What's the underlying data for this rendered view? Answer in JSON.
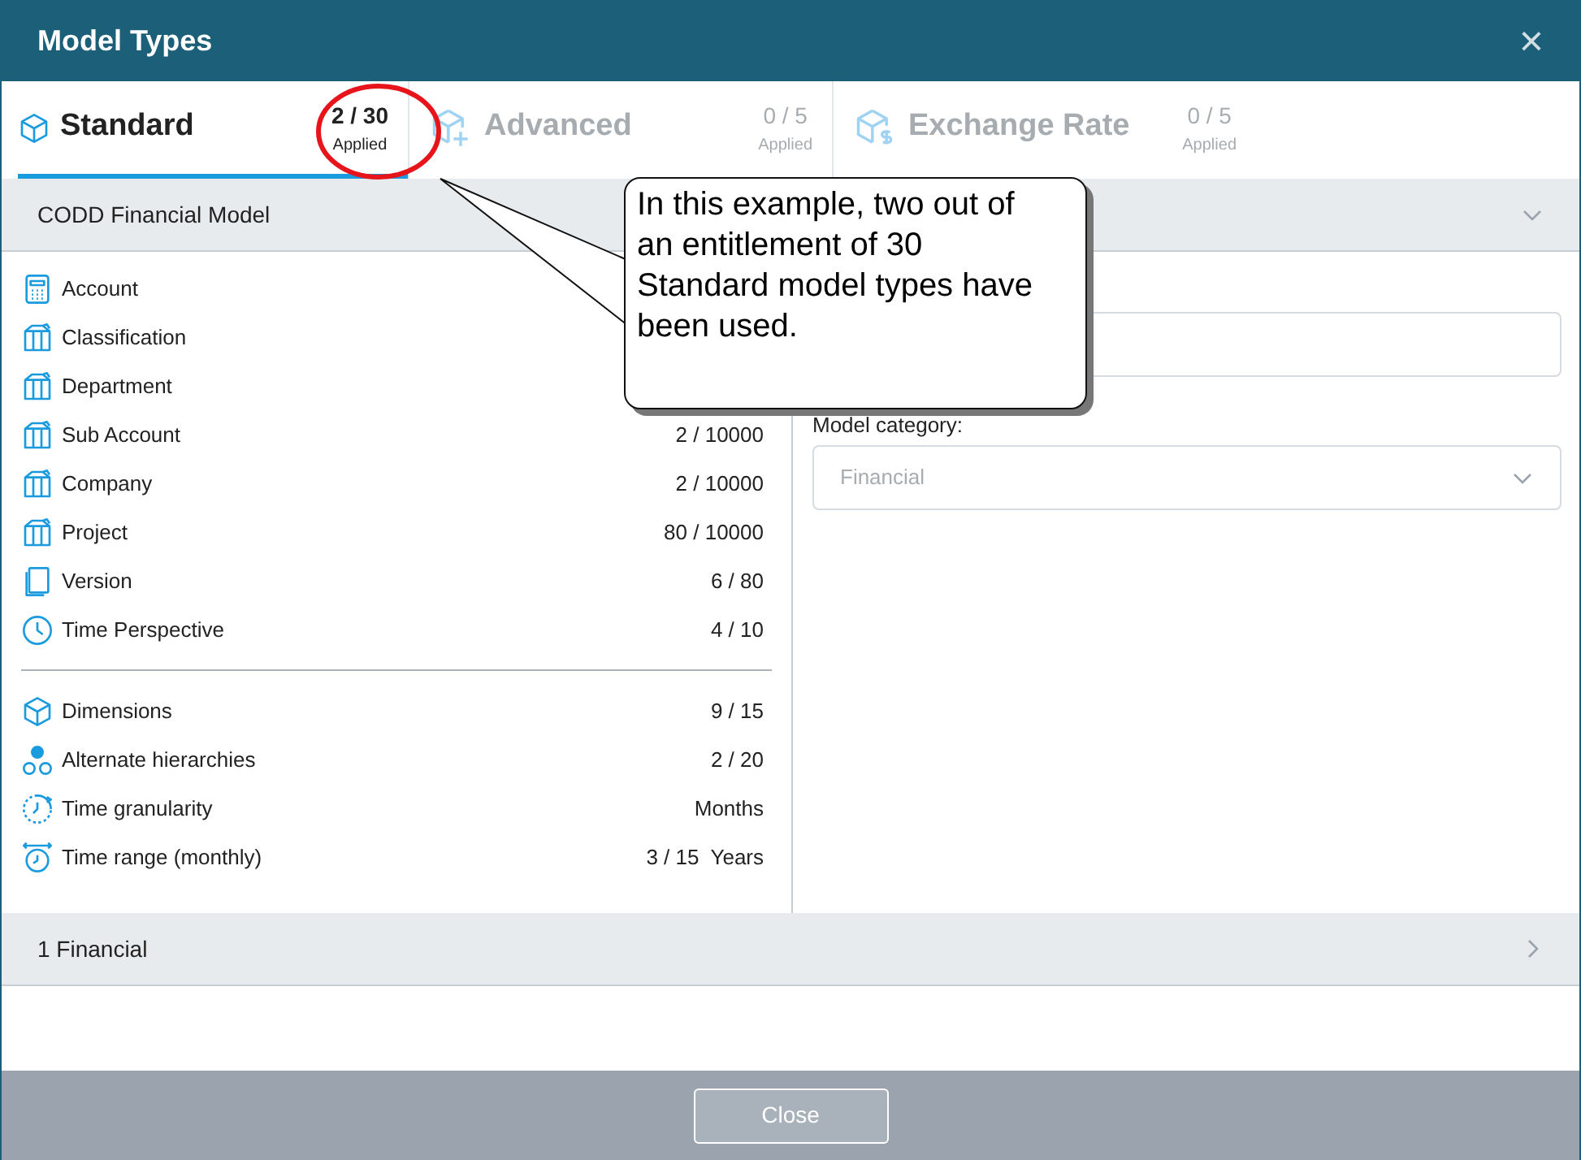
{
  "window": {
    "title": "Model Types",
    "close": "×"
  },
  "tabs": [
    {
      "label": "Standard",
      "count": "2 / 30",
      "sub": "Applied",
      "selected": true,
      "kind": "cube"
    },
    {
      "label": "Advanced",
      "count": "0 / 5",
      "sub": "Applied",
      "selected": false,
      "kind": "cube-plus"
    },
    {
      "label": "Exchange Rate",
      "count": "0 / 5",
      "sub": "Applied",
      "selected": false,
      "kind": "cube-dollar"
    }
  ],
  "section": {
    "title": "CODD Financial Model",
    "expanded": true
  },
  "groups": [
    [
      {
        "kind": "calculator",
        "label": "Account"
      },
      {
        "kind": "tree",
        "label": "Classification"
      },
      {
        "kind": "tree",
        "label": "Department"
      },
      {
        "kind": "tree",
        "label": "Sub Account",
        "value": "2 / 10000"
      },
      {
        "kind": "tree",
        "label": "Company",
        "value": "2 / 10000"
      },
      {
        "kind": "tree",
        "label": "Project",
        "value": "80 / 10000"
      },
      {
        "kind": "pages",
        "label": "Version",
        "value": "6 / 80"
      },
      {
        "kind": "clock",
        "label": "Time Perspective",
        "value": "4 / 10"
      }
    ],
    [
      {
        "kind": "cube",
        "label": "Dimensions",
        "value": "9 / 15"
      },
      {
        "kind": "circles",
        "label": "Alternate hierarchies",
        "value": "2 / 20"
      },
      {
        "kind": "clock-cycle",
        "label": "Time granularity",
        "value": "Months"
      },
      {
        "kind": "clock-range",
        "label": "Time range (monthly)",
        "value": "3 / 15  Years"
      }
    ]
  ],
  "form": {
    "category_label": "Model category:",
    "category_value": "Financial"
  },
  "second_section": {
    "title": "1 Financial",
    "expanded": false
  },
  "callout": "In this example, two out of an entitlement of 30 Standard model types have been used.",
  "buttons": [
    "Close"
  ]
}
